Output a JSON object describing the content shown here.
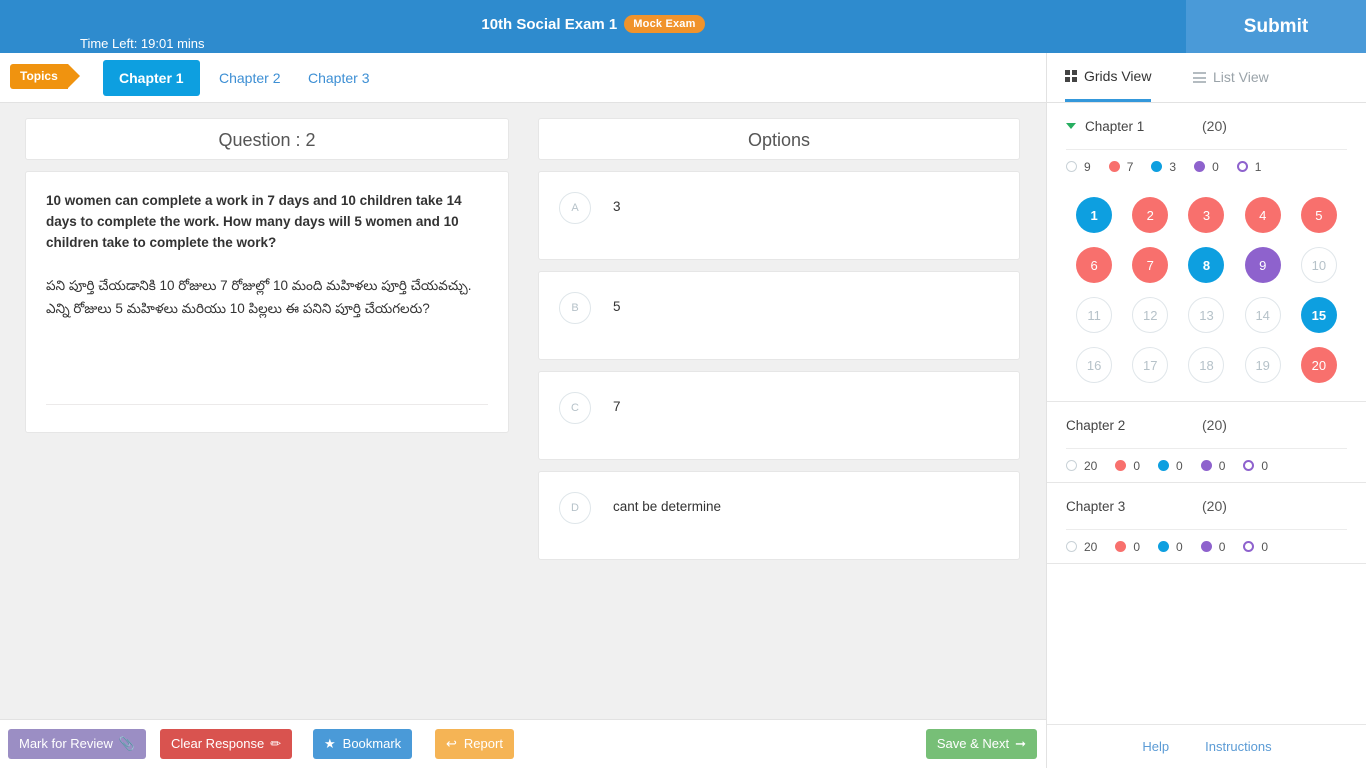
{
  "header": {
    "time_left": "Time Left: 19:01 mins",
    "exam_title": "10th Social Exam 1",
    "badge": "Mock Exam",
    "submit_label": "Submit"
  },
  "tabs": {
    "topics_label": "Topics",
    "items": [
      {
        "label": "Chapter 1",
        "active": true
      },
      {
        "label": "Chapter 2",
        "active": false
      },
      {
        "label": "Chapter 3",
        "active": false
      }
    ]
  },
  "question": {
    "header": "Question : 2",
    "text_en": "10 women can complete a work in 7 days and 10 children take 14 days to complete the work. How many days will 5 women and 10 children take to complete the work?",
    "text_te": "పని పూర్తి చేయడానికి 10 రోజులు 7 రోజుల్లో 10 మంది మహిళలు పూర్తి చేయవచ్చు. ఎన్ని రోజులు 5 మహిళలు మరియు 10 పిల్లలు ఈ పనిని పూర్తి చేయగలరు?"
  },
  "options": {
    "header": "Options",
    "items": [
      {
        "letter": "A",
        "text": "3"
      },
      {
        "letter": "B",
        "text": "5"
      },
      {
        "letter": "C",
        "text": "7"
      },
      {
        "letter": "D",
        "text": "cant be determine"
      }
    ]
  },
  "toolbar": {
    "mark_review": "Mark for Review",
    "mark_review_icon": "paperclip-icon",
    "clear_response": "Clear Response",
    "clear_response_icon": "eraser-icon",
    "bookmark": "Bookmark",
    "bookmark_icon": "star-icon",
    "report": "Report",
    "report_icon": "undo-arrow-icon",
    "save_next": "Save & Next",
    "save_next_icon": "arrow-right-icon"
  },
  "sidebar": {
    "view_tabs": [
      {
        "label": "Grids View",
        "icon": "grid-icon",
        "active": true
      },
      {
        "label": "List View",
        "icon": "list-icon",
        "active": false
      }
    ],
    "chapters": [
      {
        "name": "Chapter 1",
        "count": "(20)",
        "expanded": true,
        "legend": [
          {
            "state": "empty",
            "value": "9"
          },
          {
            "state": "red",
            "value": "7"
          },
          {
            "state": "blue",
            "value": "3"
          },
          {
            "state": "purple",
            "value": "0"
          },
          {
            "state": "purple-outline",
            "value": "1"
          }
        ],
        "questions": [
          {
            "n": "1",
            "state": "blue"
          },
          {
            "n": "2",
            "state": "red"
          },
          {
            "n": "3",
            "state": "red"
          },
          {
            "n": "4",
            "state": "red"
          },
          {
            "n": "5",
            "state": "red"
          },
          {
            "n": "6",
            "state": "red"
          },
          {
            "n": "7",
            "state": "red"
          },
          {
            "n": "8",
            "state": "blue"
          },
          {
            "n": "9",
            "state": "purple"
          },
          {
            "n": "10",
            "state": "empty"
          },
          {
            "n": "11",
            "state": "empty"
          },
          {
            "n": "12",
            "state": "empty"
          },
          {
            "n": "13",
            "state": "empty"
          },
          {
            "n": "14",
            "state": "empty"
          },
          {
            "n": "15",
            "state": "blue"
          },
          {
            "n": "16",
            "state": "empty"
          },
          {
            "n": "17",
            "state": "empty"
          },
          {
            "n": "18",
            "state": "empty"
          },
          {
            "n": "19",
            "state": "empty"
          },
          {
            "n": "20",
            "state": "red"
          }
        ]
      },
      {
        "name": "Chapter 2",
        "count": "(20)",
        "expanded": false,
        "legend": [
          {
            "state": "empty",
            "value": "20"
          },
          {
            "state": "red",
            "value": "0"
          },
          {
            "state": "blue",
            "value": "0"
          },
          {
            "state": "purple",
            "value": "0"
          },
          {
            "state": "purple-outline",
            "value": "0"
          }
        ],
        "questions": []
      },
      {
        "name": "Chapter 3",
        "count": "(20)",
        "expanded": false,
        "legend": [
          {
            "state": "empty",
            "value": "20"
          },
          {
            "state": "red",
            "value": "0"
          },
          {
            "state": "blue",
            "value": "0"
          },
          {
            "state": "purple",
            "value": "0"
          },
          {
            "state": "purple-outline",
            "value": "0"
          }
        ],
        "questions": []
      }
    ],
    "footer_links": [
      "Help",
      "Instructions"
    ]
  },
  "colors": {
    "header_blue": "#2e8bce",
    "accent_blue": "#0d9fe0",
    "answered_red": "#f8706d",
    "review_purple": "#8e62cd",
    "topics_orange": "#f0930f",
    "save_green": "#77bf77"
  }
}
